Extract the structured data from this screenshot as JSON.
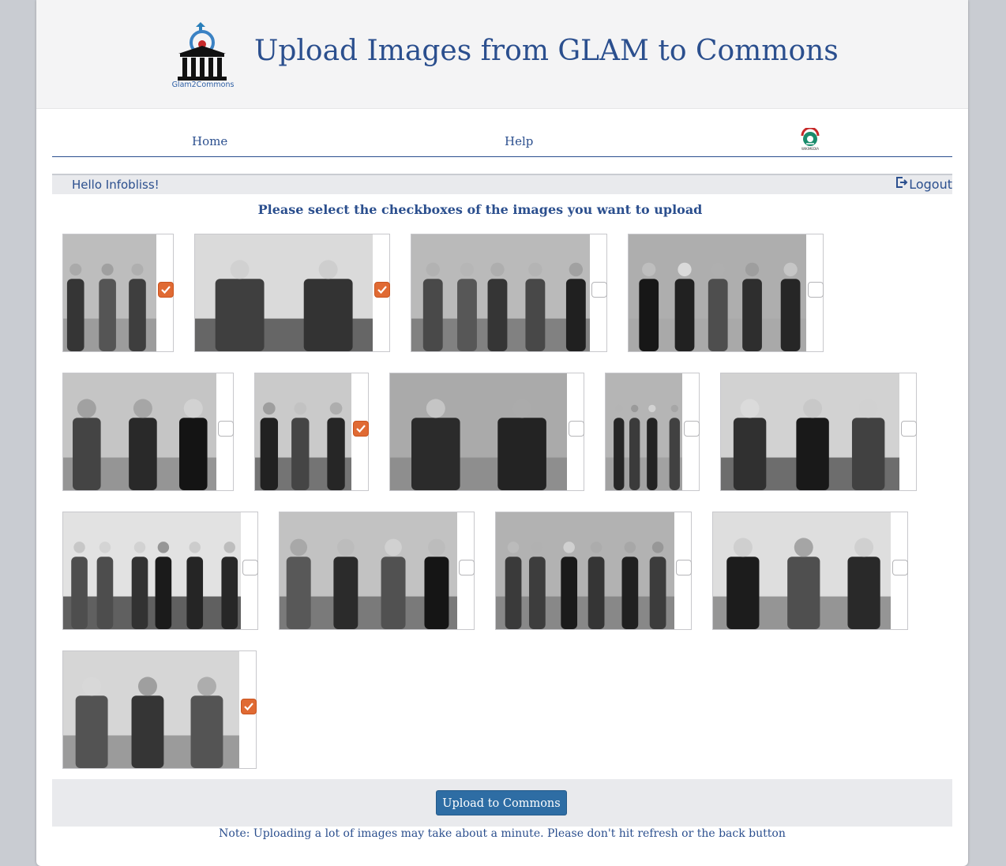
{
  "header": {
    "logo_text": "Glam2Commons",
    "title": "Upload Images from GLAM to Commons"
  },
  "nav": {
    "items": [
      {
        "label": "Home"
      },
      {
        "label": "Help"
      }
    ],
    "wikimedia_caption": "WIKIMEDIA"
  },
  "user": {
    "greeting": "Hello Infobliss!",
    "logout_label": "Logout"
  },
  "instructions": "Please select the checkboxes of the images you want to upload",
  "images": [
    {
      "checked": true
    },
    {
      "checked": true
    },
    {
      "checked": false
    },
    {
      "checked": false
    },
    {
      "checked": false
    },
    {
      "checked": true
    },
    {
      "checked": false
    },
    {
      "checked": false
    },
    {
      "checked": false
    },
    {
      "checked": false
    },
    {
      "checked": false
    },
    {
      "checked": false
    },
    {
      "checked": false
    },
    {
      "checked": true
    }
  ],
  "upload_button": "Upload to Commons",
  "note": "Note: Uploading a lot of images may take about a minute. Please don't hit refresh or the back button",
  "colors": {
    "accent": "#2b4f8e",
    "checked": "#e06a33",
    "button": "#2e6da4"
  }
}
